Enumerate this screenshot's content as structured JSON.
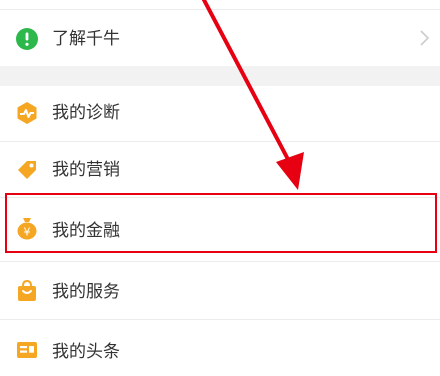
{
  "menu": {
    "items": [
      {
        "label": "了解千牛",
        "icon": "info-icon",
        "color": "#2db84c"
      },
      {
        "label": "我的诊断",
        "icon": "diagnosis-icon",
        "color": "#f5a623"
      },
      {
        "label": "我的营销",
        "icon": "tag-icon",
        "color": "#f5a623"
      },
      {
        "label": "我的金融",
        "icon": "money-bag-icon",
        "color": "#f5a623"
      },
      {
        "label": "我的服务",
        "icon": "shopping-bag-icon",
        "color": "#f5a623"
      },
      {
        "label": "我的头条",
        "icon": "news-card-icon",
        "color": "#f5a623"
      }
    ]
  },
  "annotation": {
    "highlight_color": "#e60012",
    "highlighted_item": "我的金融"
  }
}
